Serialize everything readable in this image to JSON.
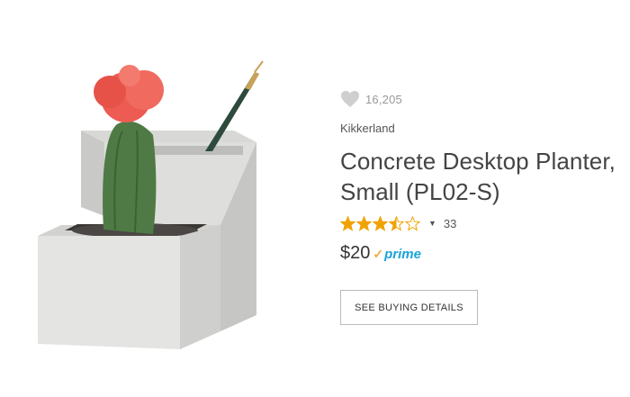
{
  "product": {
    "likes_count": "16,205",
    "brand": "Kikkerland",
    "title": "Concrete Desktop Planter, Small (PL02-S)",
    "rating": 3.5,
    "rating_max": 5,
    "review_count": "33",
    "price": "$20",
    "prime_label": "prime",
    "buy_button_label": "SEE BUYING DETAILS",
    "image_alt": "Concrete desktop planter with cactus and pen"
  },
  "colors": {
    "star": "#f0a200",
    "prime_blue": "#1aa3d9",
    "prime_check": "#f3a847",
    "heart": "#cfcfcf"
  }
}
